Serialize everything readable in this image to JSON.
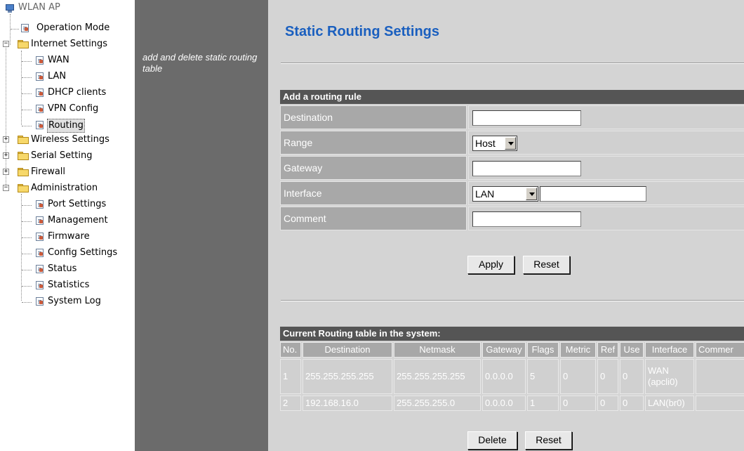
{
  "tree": {
    "root": "WLAN AP",
    "items": [
      {
        "label": "Operation Mode"
      },
      {
        "label": "Internet Settings"
      },
      {
        "label": "WAN"
      },
      {
        "label": "LAN"
      },
      {
        "label": "DHCP clients"
      },
      {
        "label": "VPN Config"
      },
      {
        "label": "Routing"
      },
      {
        "label": "Wireless Settings"
      },
      {
        "label": "Serial Setting"
      },
      {
        "label": "Firewall"
      },
      {
        "label": "Administration"
      },
      {
        "label": "Port Settings"
      },
      {
        "label": "Management"
      },
      {
        "label": "Firmware"
      },
      {
        "label": "Config Settings"
      },
      {
        "label": "Status"
      },
      {
        "label": "Statistics"
      },
      {
        "label": "System Log"
      }
    ],
    "selected": "Routing",
    "expand_signs": {
      "minus": "−",
      "plus": "+"
    }
  },
  "description": "add and delete static routing table",
  "page_title": "Static Routing Settings",
  "add_rule": {
    "header": "Add a routing rule",
    "destination_label": "Destination",
    "destination_value": "",
    "range_label": "Range",
    "range_value": "Host",
    "gateway_label": "Gateway",
    "gateway_value": "",
    "interface_label": "Interface",
    "interface_value": "LAN",
    "interface_custom_value": "",
    "comment_label": "Comment",
    "comment_value": "",
    "apply_label": "Apply",
    "reset_label": "Reset"
  },
  "routing_table": {
    "header": "Current Routing table in the system:",
    "columns": [
      "No.",
      "Destination",
      "Netmask",
      "Gateway",
      "Flags",
      "Metric",
      "Ref",
      "Use",
      "Interface",
      "Commer"
    ],
    "rows": [
      [
        "1",
        "255.255.255.255",
        "255.255.255.255",
        "0.0.0.0",
        "5",
        "0",
        "0",
        "0",
        "WAN (apcli0)",
        ""
      ],
      [
        "2",
        "192.168.16.0",
        "255.255.255.0",
        "0.0.0.0",
        "1",
        "0",
        "0",
        "0",
        "LAN(br0)",
        ""
      ]
    ],
    "delete_label": "Delete",
    "reset_label": "Reset"
  }
}
